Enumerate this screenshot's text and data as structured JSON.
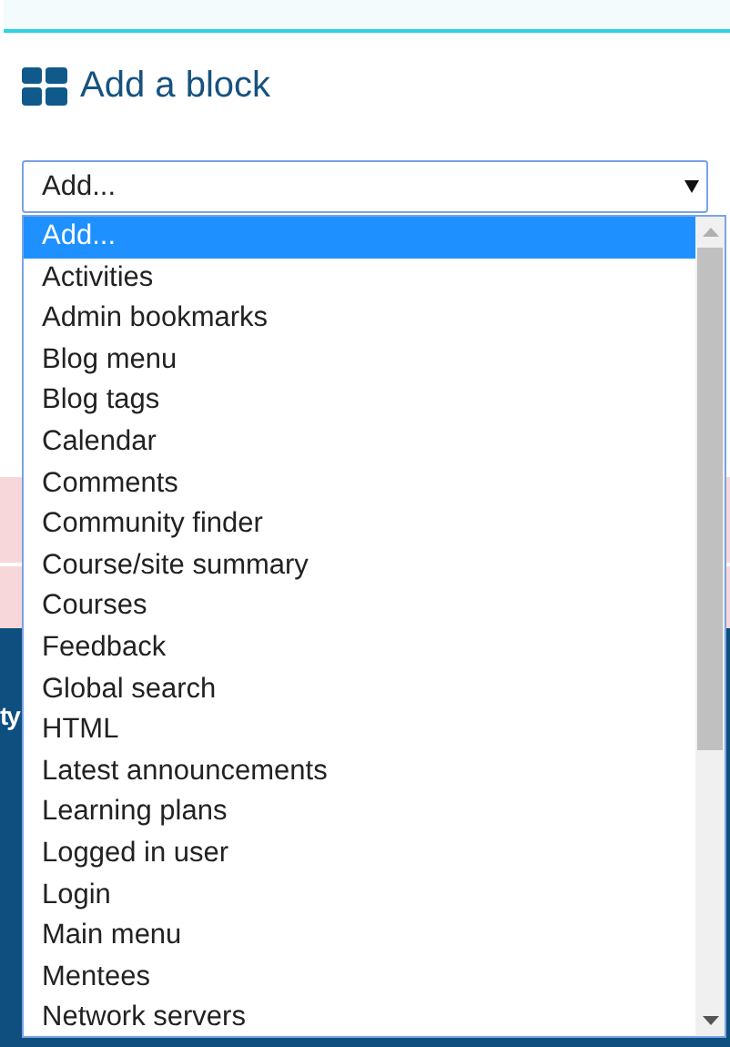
{
  "heading": "Add a block",
  "select": {
    "value": "Add..."
  },
  "background_text": "ty",
  "options": [
    {
      "label": "Add...",
      "selected": true
    },
    {
      "label": "Activities",
      "selected": false
    },
    {
      "label": "Admin bookmarks",
      "selected": false
    },
    {
      "label": "Blog menu",
      "selected": false
    },
    {
      "label": "Blog tags",
      "selected": false
    },
    {
      "label": "Calendar",
      "selected": false
    },
    {
      "label": "Comments",
      "selected": false
    },
    {
      "label": "Community finder",
      "selected": false
    },
    {
      "label": "Course/site summary",
      "selected": false
    },
    {
      "label": "Courses",
      "selected": false
    },
    {
      "label": "Feedback",
      "selected": false
    },
    {
      "label": "Global search",
      "selected": false
    },
    {
      "label": "HTML",
      "selected": false
    },
    {
      "label": "Latest announcements",
      "selected": false
    },
    {
      "label": "Learning plans",
      "selected": false
    },
    {
      "label": "Logged in user",
      "selected": false
    },
    {
      "label": "Login",
      "selected": false
    },
    {
      "label": "Main menu",
      "selected": false
    },
    {
      "label": "Mentees",
      "selected": false
    },
    {
      "label": "Network servers",
      "selected": false
    }
  ]
}
